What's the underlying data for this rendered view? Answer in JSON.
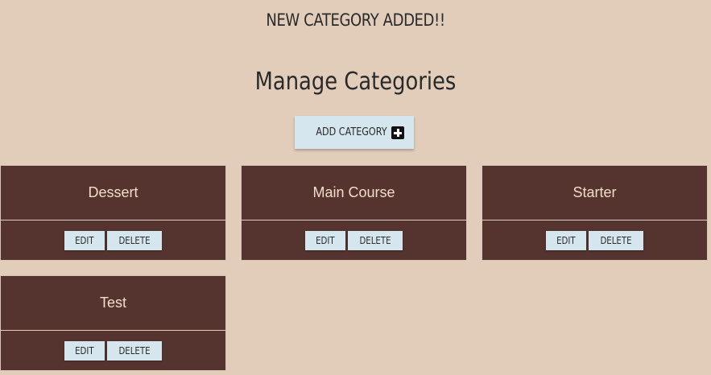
{
  "flash_message": "NEW CATEGORY ADDED!!",
  "page_title": "Manage Categories",
  "add_button": {
    "label": "ADD CATEGORY",
    "icon": "plus-square-icon"
  },
  "categories": [
    {
      "name": "Dessert",
      "edit_label": "EDIT",
      "delete_label": "DELETE"
    },
    {
      "name": "Main Course",
      "edit_label": "EDIT",
      "delete_label": "DELETE"
    },
    {
      "name": "Starter",
      "edit_label": "EDIT",
      "delete_label": "DELETE"
    },
    {
      "name": "Test",
      "edit_label": "EDIT",
      "delete_label": "DELETE"
    }
  ],
  "colors": {
    "background": "#e2cdbb",
    "card": "#553430",
    "card_text": "#f3ddc8",
    "button": "#d6e6ee"
  }
}
